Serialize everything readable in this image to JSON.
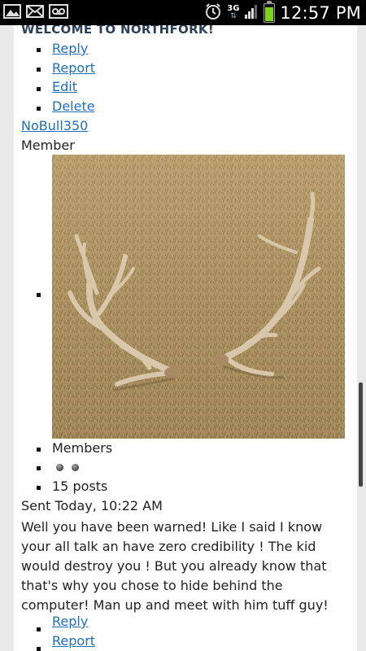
{
  "status_bar": {
    "time": "12:57 PM",
    "network": "3G",
    "icons": [
      "image-icon",
      "mail-icon",
      "voicemail-icon",
      "alarm-icon",
      "signal-icon",
      "battery-icon"
    ],
    "battery_color": "#7ed321"
  },
  "post_top": {
    "heading": "WELCOME TO NORTHFORK!",
    "actions": [
      "Reply",
      "Report",
      "Edit",
      "Delete"
    ]
  },
  "author": {
    "name": "NoBull350",
    "role": "Member",
    "group": "Members",
    "posts": "15 posts",
    "rep_dots": 2
  },
  "message": {
    "sent": "Sent Today, 10:22 AM",
    "body": "Well you have been warned! Like I said I know your all talk an have zero credibility ! The kid would destroy you ! But you already know that that's why you chose to hide behind the computer! Man up and meet with him tuff guy!",
    "actions": [
      "Reply",
      "Report"
    ]
  },
  "colors": {
    "link": "#1f6fbf",
    "heading": "#2b3f55"
  }
}
